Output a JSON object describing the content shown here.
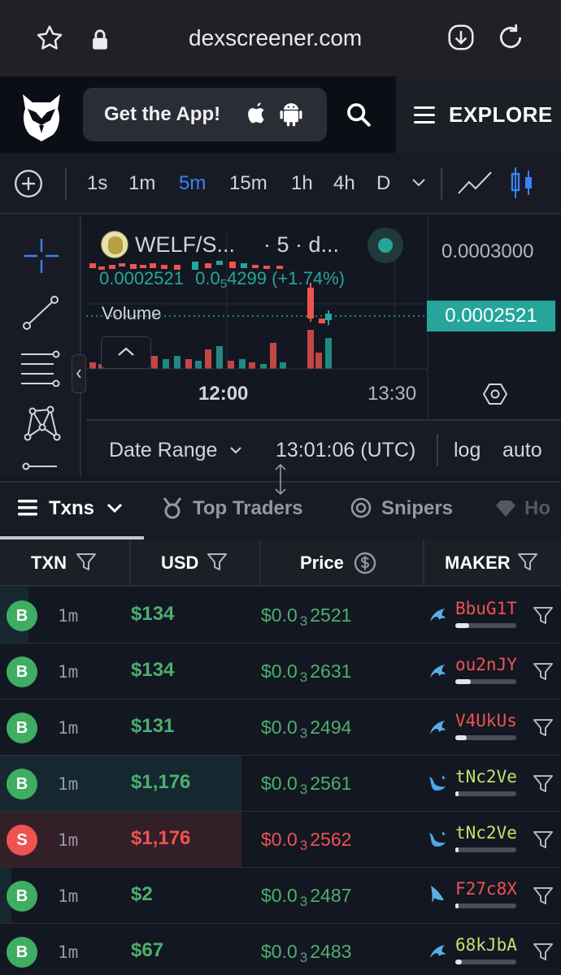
{
  "browser": {
    "url": "dexscreener.com"
  },
  "header": {
    "get_app_label": "Get the App!",
    "explore_label": "EXPLORE"
  },
  "timeframes": [
    "1s",
    "1m",
    "5m",
    "15m",
    "1h",
    "4h",
    "D"
  ],
  "active_timeframe": "5m",
  "chart": {
    "pair_label": "WELF/S...",
    "interval_label": "· 5 · d...",
    "top_price": "0.0003000",
    "ohlc_close": "0.0002521",
    "ohlc_change": "0.0",
    "ohlc_change_sub": "5",
    "ohlc_change_rest": "4299 (+1.74%)",
    "volume_label": "Volume",
    "current_price": "0.0002521",
    "time_label_1": "12:00",
    "time_label_2": "13:30",
    "date_range_label": "Date Range",
    "clock": "13:01:06 (UTC)",
    "log_label": "log",
    "auto_label": "auto"
  },
  "tabs": {
    "txns": "Txns",
    "top_traders": "Top Traders",
    "snipers": "Snipers",
    "holders": "Ho"
  },
  "table": {
    "headers": {
      "txn": "TXN",
      "usd": "USD",
      "price": "Price",
      "maker": "MAKER"
    },
    "rows": [
      {
        "type": "B",
        "age": "1m",
        "usd": "$134",
        "price_pre": "$0.0",
        "price_sub": "3",
        "price_post": "2521",
        "maker": "BbuG1T",
        "maker_color": "#ef5350",
        "maker_bar": 0.22,
        "whale_bar": 0.05
      },
      {
        "type": "B",
        "age": "1m",
        "usd": "$134",
        "price_pre": "$0.0",
        "price_sub": "3",
        "price_post": "2631",
        "maker": "ou2nJY",
        "maker_color": "#ef5350",
        "maker_bar": 0.25,
        "whale_bar": 0.0
      },
      {
        "type": "B",
        "age": "1m",
        "usd": "$131",
        "price_pre": "$0.0",
        "price_sub": "3",
        "price_post": "2494",
        "maker": "V4UkUs",
        "maker_color": "#ef5350",
        "maker_bar": 0.18,
        "whale_bar": 0.0
      },
      {
        "type": "B",
        "age": "1m",
        "usd": "$1,176",
        "price_pre": "$0.0",
        "price_sub": "3",
        "price_post": "2561",
        "maker": "tNc2Ve",
        "maker_color": "#c0e36a",
        "maker_bar": 0.05,
        "whale_bar": 0.43
      },
      {
        "type": "S",
        "age": "1m",
        "usd": "$1,176",
        "price_pre": "$0.0",
        "price_sub": "3",
        "price_post": "2562",
        "maker": "tNc2Ve",
        "maker_color": "#c0e36a",
        "maker_bar": 0.05,
        "whale_bar": 0.43
      },
      {
        "type": "B",
        "age": "1m",
        "usd": "$2",
        "price_pre": "$0.0",
        "price_sub": "3",
        "price_post": "2487",
        "maker": "F27c8X",
        "maker_color": "#ef5350",
        "maker_bar": 0.05,
        "whale_bar": 0.02
      },
      {
        "type": "B",
        "age": "1m",
        "usd": "$67",
        "price_pre": "$0.0",
        "price_sub": "3",
        "price_post": "2483",
        "maker": "68kJbA",
        "maker_color": "#c0e36a",
        "maker_bar": 0.1,
        "whale_bar": 0.0
      }
    ]
  },
  "colors": {
    "buy": "#26a69a",
    "buy_text": "#4caf6e",
    "sell": "#ef5350",
    "accent": "#3b82f6"
  },
  "icons": [
    "star-icon",
    "lock-icon",
    "download-icon",
    "reload-icon",
    "owl-logo-icon",
    "apple-icon",
    "android-icon",
    "search-icon",
    "menu-icon",
    "plus-circle-icon",
    "chevron-down-icon",
    "line-chart-icon",
    "candlestick-icon",
    "crosshair-icon",
    "trendline-icon",
    "fib-icon",
    "pattern-icon",
    "settings-hex-icon",
    "filter-icon",
    "dollar-circle-icon",
    "trophy-icon",
    "target-icon",
    "diamond-icon",
    "whale-icon",
    "shark-icon",
    "dolphin-icon"
  ]
}
